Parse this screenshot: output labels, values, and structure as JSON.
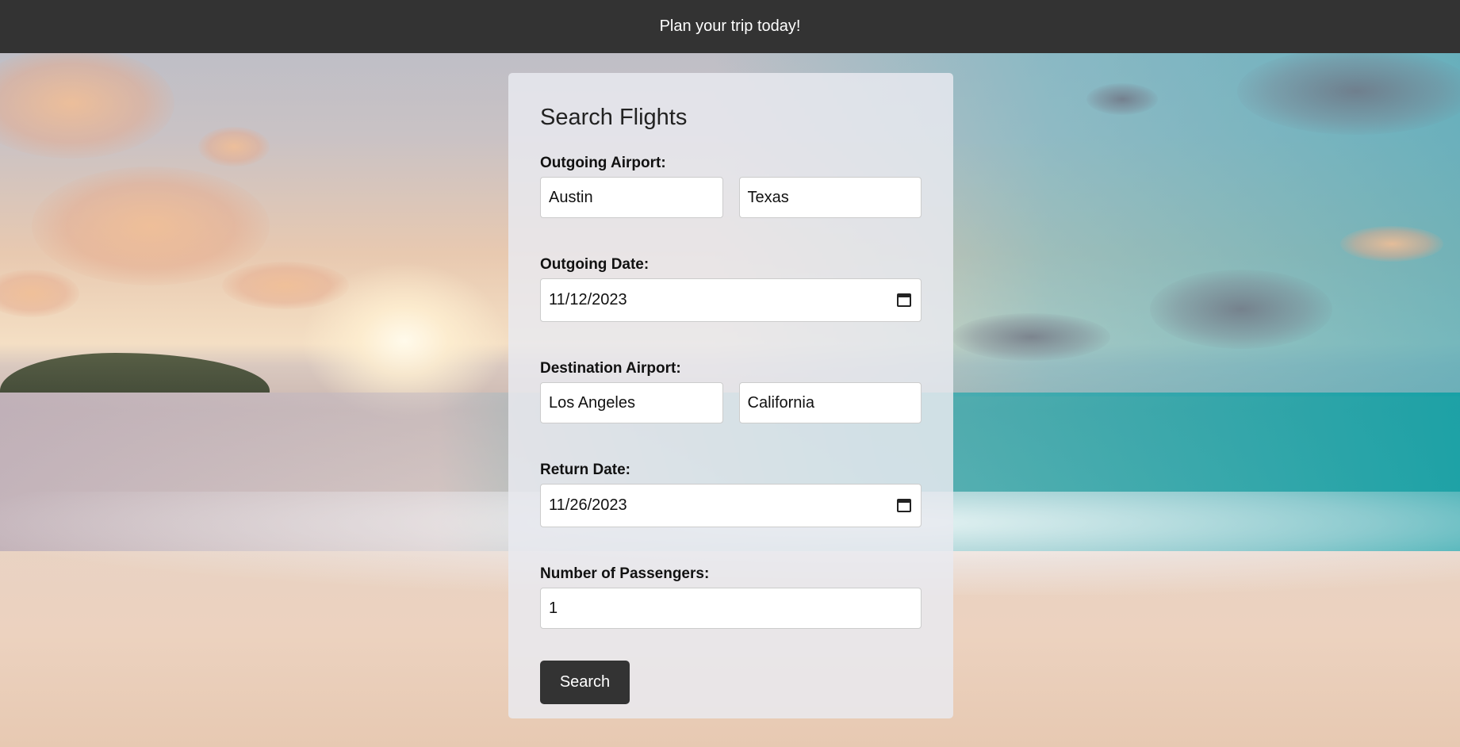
{
  "banner": {
    "text": "Plan your trip today!"
  },
  "form": {
    "title": "Search Flights",
    "outgoing_airport": {
      "label": "Outgoing Airport:",
      "city": "Austin",
      "state": "Texas"
    },
    "outgoing_date": {
      "label": "Outgoing Date:",
      "value": "11/12/2023"
    },
    "destination_airport": {
      "label": "Destination Airport:",
      "city": "Los Angeles",
      "state": "California"
    },
    "return_date": {
      "label": "Return Date:",
      "value": "11/26/2023"
    },
    "passengers": {
      "label": "Number of Passengers:",
      "value": "1"
    },
    "search_label": "Search"
  },
  "colors": {
    "banner_bg": "#333333",
    "button_bg": "#333333",
    "card_bg": "#e8eaf0"
  }
}
